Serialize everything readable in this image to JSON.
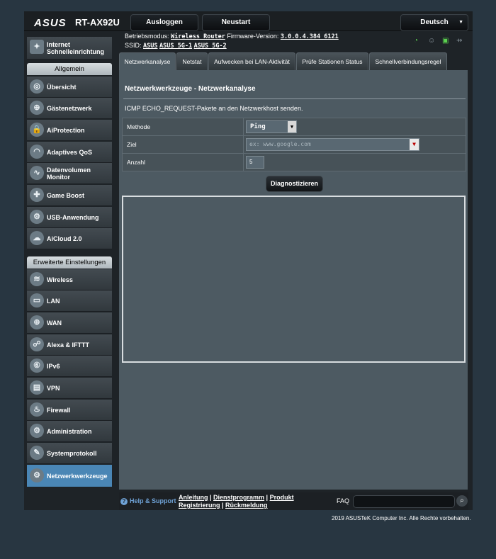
{
  "header": {
    "logo": "ASUS",
    "model": "RT-AX92U",
    "logout_label": "Ausloggen",
    "reboot_label": "Neustart",
    "language": "Deutsch"
  },
  "info": {
    "mode_label": "Betriebsmodus:",
    "mode_value": "Wireless Router",
    "firmware_label": "Firmware-Version:",
    "firmware_value": "3.0.0.4.384_6121",
    "ssid_label": "SSID:",
    "ssids": [
      "ASUS",
      "ASUS_5G-1",
      "ASUS_5G-2"
    ]
  },
  "status_icons": [
    "wan-status-icon",
    "clients-icon",
    "usb-device-icon",
    "usb-icon"
  ],
  "sidebar": {
    "quick_setup": "Internet Schnelleinrichtung",
    "general_header": "Allgemein",
    "general_items": [
      {
        "label": "Übersicht",
        "icon": "overview-icon"
      },
      {
        "label": "Gästenetzwerk",
        "icon": "guest-network-icon"
      },
      {
        "label": "AiProtection",
        "icon": "aiprotection-icon"
      },
      {
        "label": "Adaptives QoS",
        "icon": "qos-icon"
      },
      {
        "label": "Datenvolumen Monitor",
        "icon": "traffic-monitor-icon"
      },
      {
        "label": "Game Boost",
        "icon": "gamepad-icon"
      },
      {
        "label": "USB-Anwendung",
        "icon": "usb-app-icon"
      },
      {
        "label": "AiCloud 2.0",
        "icon": "cloud-icon"
      }
    ],
    "advanced_header": "Erweiterte Einstellungen",
    "advanced_items": [
      {
        "label": "Wireless",
        "icon": "wireless-icon"
      },
      {
        "label": "LAN",
        "icon": "lan-icon"
      },
      {
        "label": "WAN",
        "icon": "wan-globe-icon"
      },
      {
        "label": "Alexa & IFTTT",
        "icon": "alexa-icon"
      },
      {
        "label": "IPv6",
        "icon": "ipv6-icon"
      },
      {
        "label": "VPN",
        "icon": "vpn-icon"
      },
      {
        "label": "Firewall",
        "icon": "firewall-icon"
      },
      {
        "label": "Administration",
        "icon": "admin-icon"
      },
      {
        "label": "Systemprotokoll",
        "icon": "syslog-icon"
      },
      {
        "label": "Netzwerkwerkzeuge",
        "icon": "network-tools-icon"
      }
    ]
  },
  "tabs": [
    "Netzwerkanalyse",
    "Netstat",
    "Aufwecken bei LAN-Aktivität",
    "Prüfe Stationen Status",
    "Schnellverbindungsregel"
  ],
  "main": {
    "title": "Netzwerkwerkzeuge - Netzwerkanalyse",
    "description": "ICMP ECHO_REQUEST-Pakete an den Netzwerkhost senden.",
    "method_label": "Methode",
    "method_value": "Ping",
    "target_label": "Ziel",
    "target_placeholder": "ex: www.google.com",
    "count_label": "Anzahl",
    "count_value": "5",
    "diagnose_label": "Diagnostizieren"
  },
  "footer": {
    "help": "Help & Support",
    "links_line1": [
      "Anleitung",
      "Dienstprogramm",
      "Produkt"
    ],
    "links_line2": [
      "Registrierung",
      "Rückmeldung"
    ],
    "faq": "FAQ",
    "copyright": "2019 ASUSTeK Computer Inc. Alle Rechte vorbehalten."
  },
  "colors": {
    "background": "#283641",
    "content_panel": "#4d5a62",
    "active_menu": "#4a86b5",
    "help_link": "#6fa2d6",
    "status_green": "#5bd24f"
  }
}
